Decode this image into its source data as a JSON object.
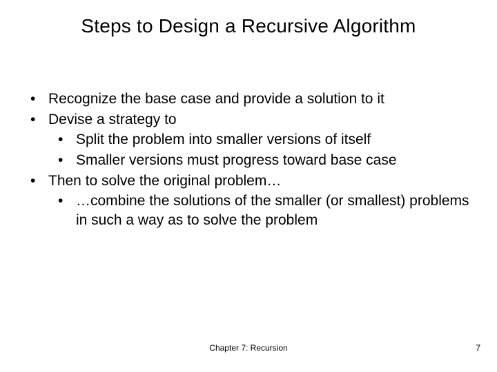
{
  "title": "Steps to Design a Recursive Algorithm",
  "bullets": {
    "b1": "Recognize the base case and provide a solution to it",
    "b2": "Devise a strategy to",
    "b2_1": "Split the problem into smaller versions of itself",
    "b2_2": "Smaller versions must progress toward base case",
    "b3": "Then to solve the original problem…",
    "b3_1": "…combine the solutions of the smaller (or smallest) problems in such a way as to solve the problem"
  },
  "footer": {
    "chapter": "Chapter 7: Recursion",
    "page": "7"
  }
}
